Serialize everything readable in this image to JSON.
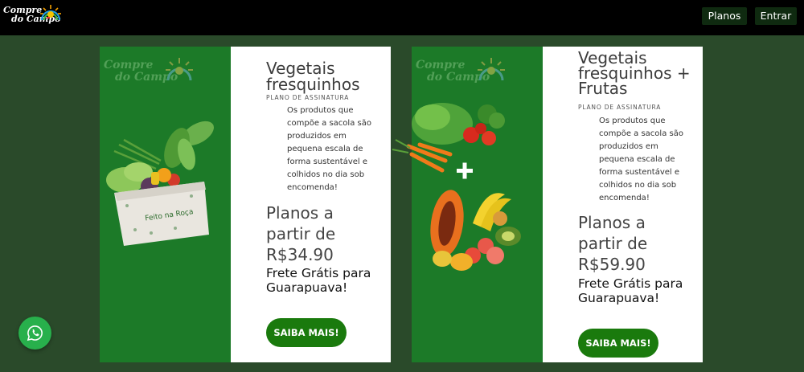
{
  "header": {
    "logo_line1": "Compre",
    "logo_line2": "do Campo",
    "nav": {
      "planos": "Planos",
      "entrar": "Entrar"
    }
  },
  "plans": [
    {
      "watermark_line1": "Compre",
      "watermark_line2": "do Campo",
      "title": "Vegetais fresquinhos",
      "subtitle": "PLANO DE ASSINATURA",
      "description": "Os produtos que compõe a sacola são produzidos em pequena escala de forma sustentável e colhidos no dia sob encomenda!",
      "price": "Planos a partir de R$34.90",
      "frete": "Frete Grátis para Guarapuava!",
      "cta": "SAIBA MAIS!",
      "bag_text": "Feito na Roça"
    },
    {
      "watermark_line1": "Compre",
      "watermark_line2": "do Campo",
      "title": "Vegetais fresquinhos + Frutas",
      "subtitle": "PLANO DE ASSINATURA",
      "description": "Os produtos que compõe a sacola são produzidos em pequena escala de forma sustentável e colhidos no dia sob encomenda!",
      "price": "Planos a partir de R$59.90",
      "frete": "Frete Grátis para Guarapuava!",
      "cta": "SAIBA MAIS!"
    }
  ],
  "colors": {
    "page_background": "#2a4a2a",
    "header_background": "#000000",
    "card_green": "#1c7a28",
    "button_green": "#1a7a0d",
    "whatsapp_green": "#28b04c"
  },
  "icons": {
    "whatsapp": "whatsapp-icon",
    "logo_sun": "sun-rays-icon"
  }
}
